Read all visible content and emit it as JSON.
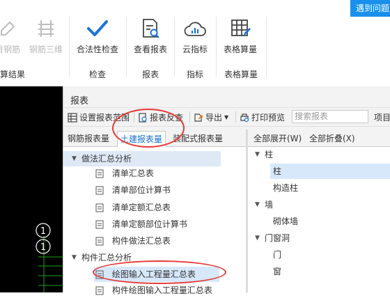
{
  "help_button": "遇到问题",
  "ribbon": {
    "buttons": [
      {
        "label": "目钢筋",
        "icon": "rebar-pencil-icon"
      },
      {
        "label": "钢筋三维",
        "icon": "rebar-3d-icon"
      },
      {
        "label": "合法性检查",
        "icon": "checkmark-icon"
      },
      {
        "label": "查看报表",
        "icon": "report-search-icon"
      },
      {
        "label": "云指标",
        "icon": "cloud-index-icon"
      },
      {
        "label": "表格算量",
        "icon": "table-edit-icon"
      }
    ],
    "groups": [
      "算结果",
      "检查",
      "报表",
      "指标",
      "表格算量"
    ]
  },
  "canvas": {
    "markers": [
      "1",
      "1"
    ]
  },
  "dialog": {
    "title": "报表",
    "toolbar": {
      "set_range": "设置报表范围",
      "reverse": "报表反查",
      "export": "导出",
      "print_preview": "打印预览",
      "search_placeholder": "搜索报表",
      "item": "项目"
    },
    "tabs": [
      "钢筋报表量",
      "土建报表量",
      "装配式报表量"
    ],
    "active_tab": "土建报表量",
    "right_header": {
      "expand_all": "全部展开(W)",
      "collapse_all": "全部折叠(X)"
    },
    "left_tree": [
      {
        "label": "做法汇总分析",
        "level": 0,
        "expanded": true
      },
      {
        "label": "清单汇总表",
        "level": 1
      },
      {
        "label": "清单部位计算书",
        "level": 1
      },
      {
        "label": "清单定额汇总表",
        "level": 1
      },
      {
        "label": "清单定额部位计算书",
        "level": 1
      },
      {
        "label": "构件做法汇总表",
        "level": 1
      },
      {
        "label": "构件汇总分析",
        "level": 0,
        "expanded": true
      },
      {
        "label": "绘图输入工程量汇总表",
        "level": 1,
        "selected": true
      },
      {
        "label": "构件绘图输入工程量汇总表",
        "level": 1
      }
    ],
    "right_tree": [
      {
        "label": "柱",
        "level": 0,
        "expanded": true
      },
      {
        "label": "柱",
        "level": 1,
        "selected": true
      },
      {
        "label": "构造柱",
        "level": 1
      },
      {
        "label": "墙",
        "level": 0,
        "expanded": true
      },
      {
        "label": "砌体墙",
        "level": 1
      },
      {
        "label": "门窗洞",
        "level": 0,
        "expanded": true
      },
      {
        "label": "门",
        "level": 1
      },
      {
        "label": "窗",
        "level": 1
      }
    ]
  },
  "colors": {
    "accent": "#1a90ee",
    "annotation": "#e53935",
    "selection": "#d7e8fb"
  }
}
